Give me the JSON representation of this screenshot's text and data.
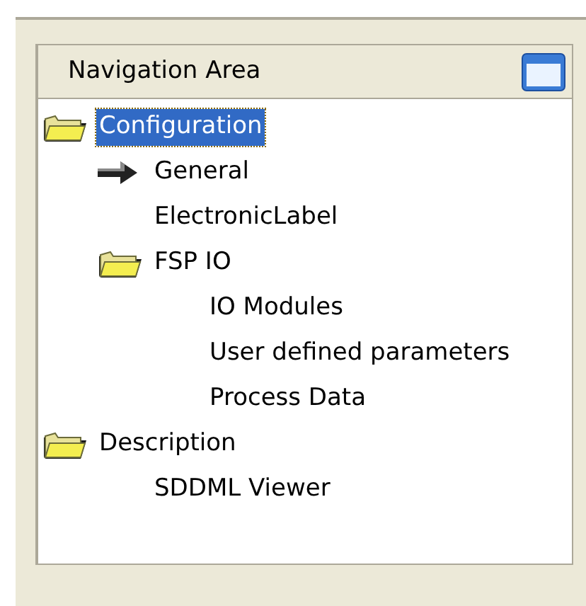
{
  "panel": {
    "title": "Navigation Area"
  },
  "tree": [
    {
      "label": "Configuration",
      "kind": "folder",
      "selected": true,
      "children": [
        {
          "label": "General",
          "kind": "page",
          "selected": false
        },
        {
          "label": "ElectronicLabel",
          "selected": false
        },
        {
          "label": "FSP IO",
          "kind": "folder",
          "selected": false,
          "children": [
            {
              "label": "IO Modules",
              "selected": false
            },
            {
              "label": "User defined parameters",
              "selected": false
            },
            {
              "label": "Process Data",
              "selected": false
            }
          ]
        }
      ]
    },
    {
      "label": "Description",
      "kind": "folder",
      "selected": false,
      "children": [
        {
          "label": "SDDML Viewer",
          "selected": false
        }
      ]
    }
  ]
}
